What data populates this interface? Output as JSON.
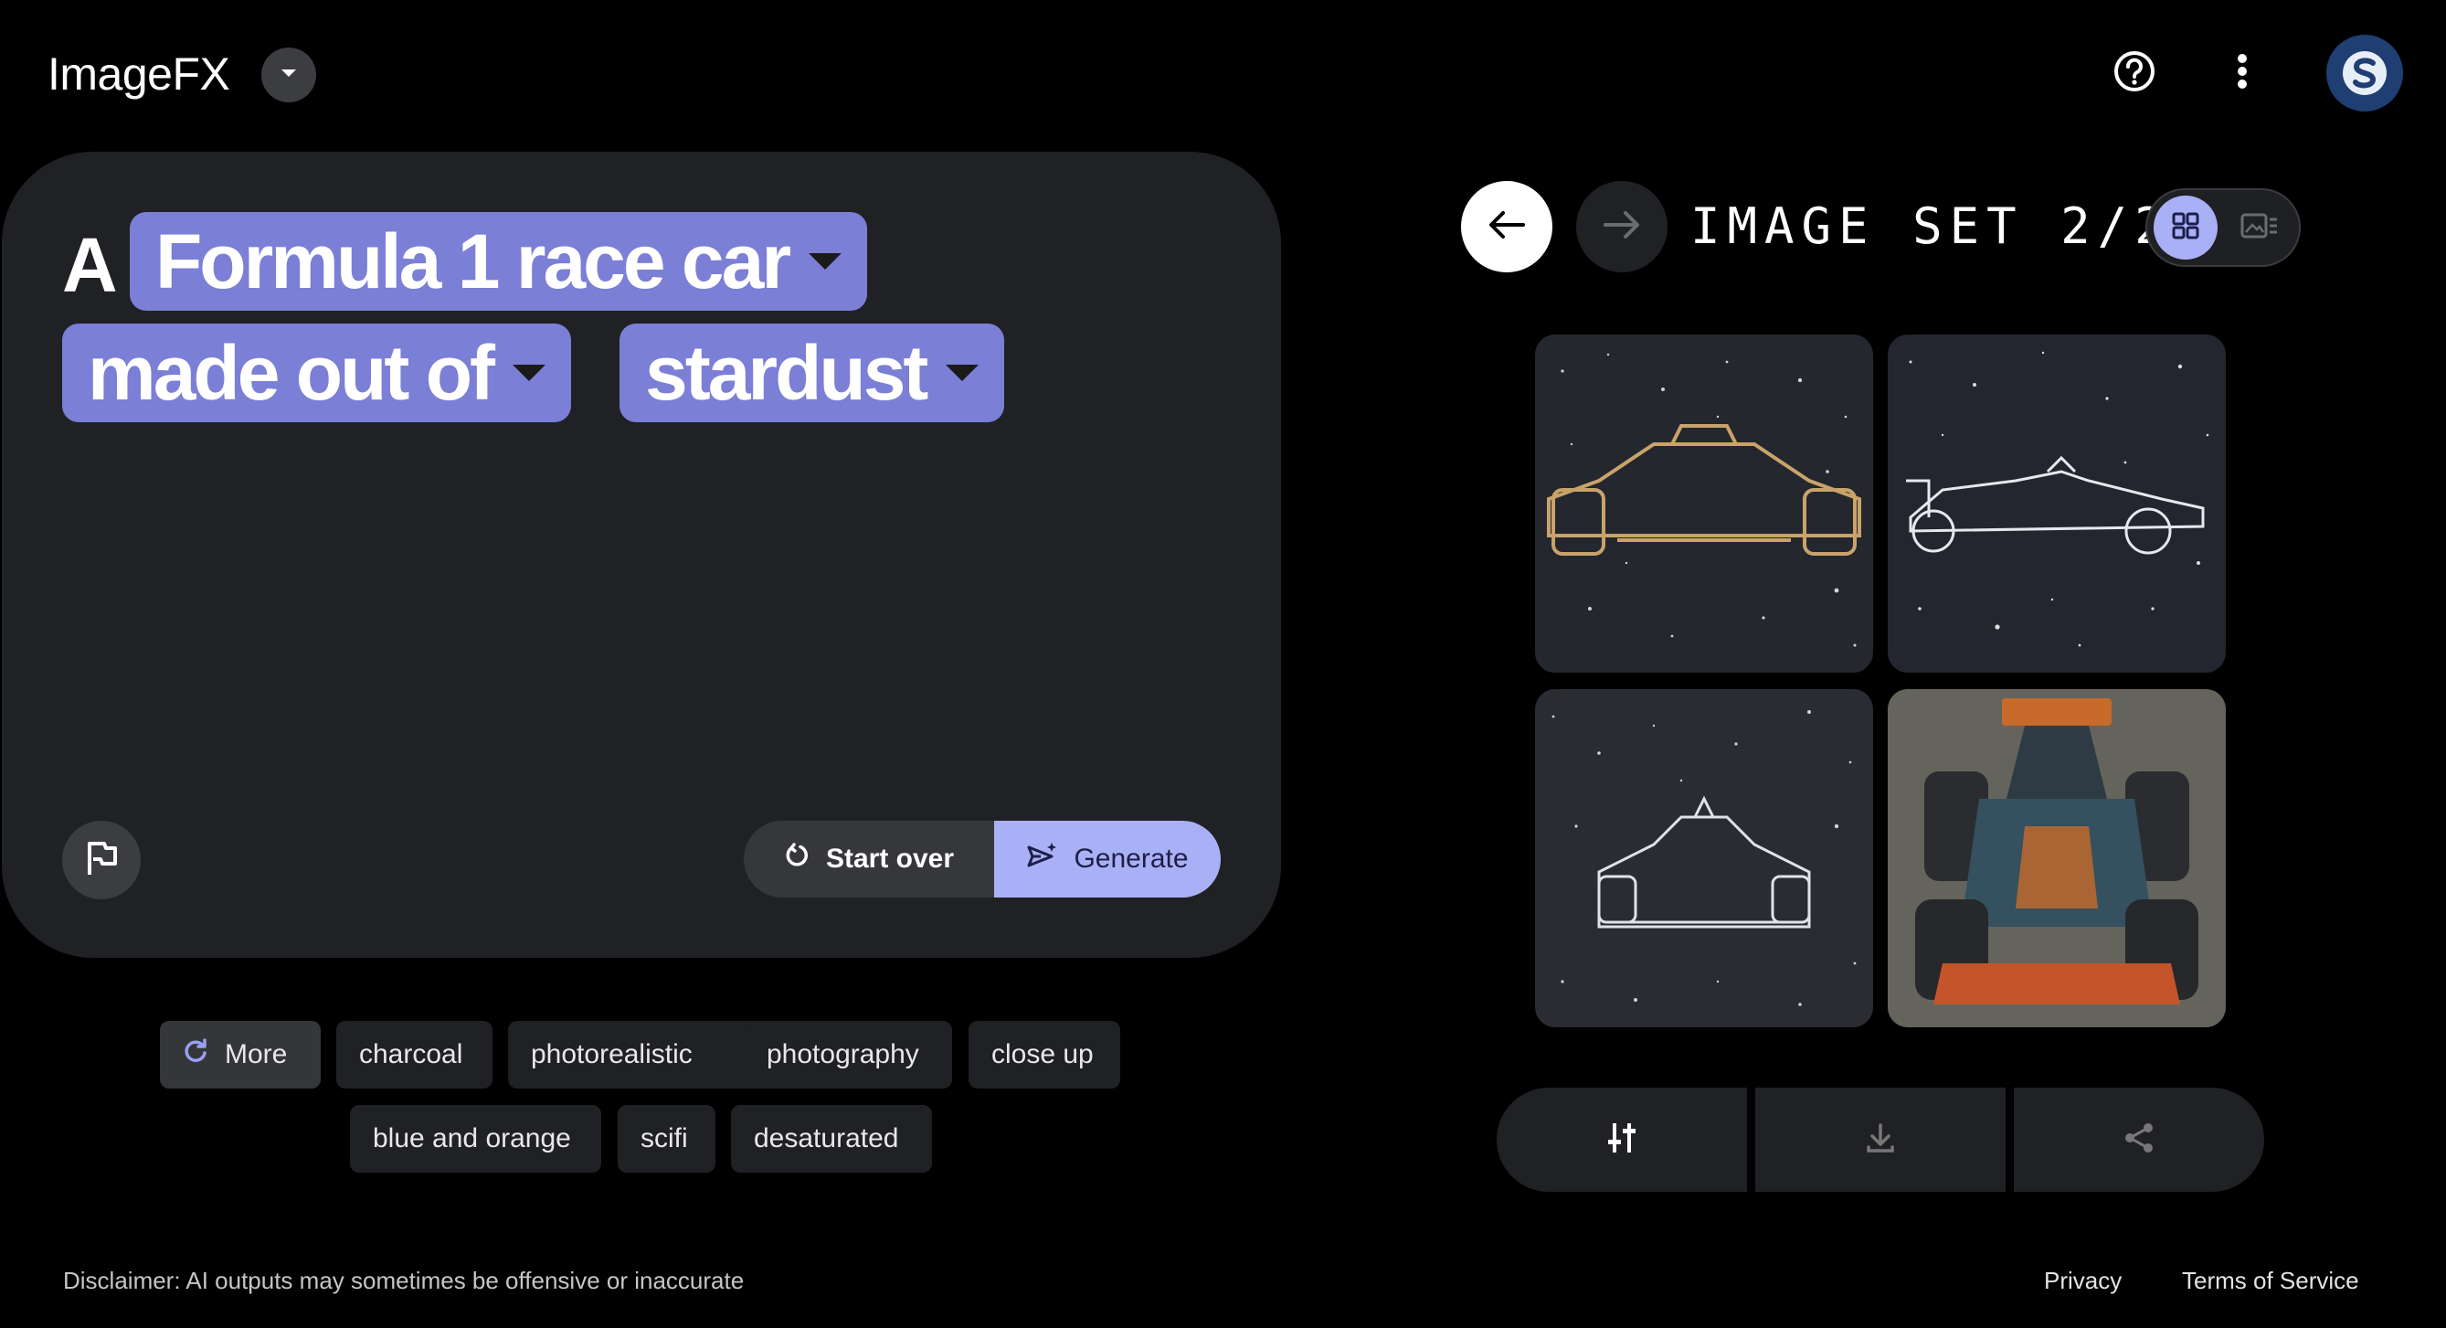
{
  "header": {
    "logo": "ImageFX",
    "icons": [
      "chevron-down-icon",
      "help-icon",
      "more-vert-icon",
      "avatar"
    ]
  },
  "prompt": {
    "prefix": "A",
    "chips": [
      {
        "label": "Formula 1 race car"
      },
      {
        "label": "made out of"
      },
      {
        "label": "stardust"
      }
    ],
    "start_over_label": "Start over",
    "generate_label": "Generate"
  },
  "suggestions": {
    "more_label": "More",
    "items": [
      "charcoal",
      "photorealistic",
      "photography",
      "close up",
      "blue and orange",
      "scifi",
      "desaturated"
    ]
  },
  "image_set": {
    "label": "IMAGE SET 2/2"
  },
  "footer": {
    "disclaimer": "Disclaimer: AI outputs may sometimes be offensive or inaccurate",
    "privacy": "Privacy",
    "terms": "Terms of Service"
  },
  "colors": {
    "chip": "#7b7fd6",
    "generate": "#aab0f5",
    "panel": "#202124"
  }
}
